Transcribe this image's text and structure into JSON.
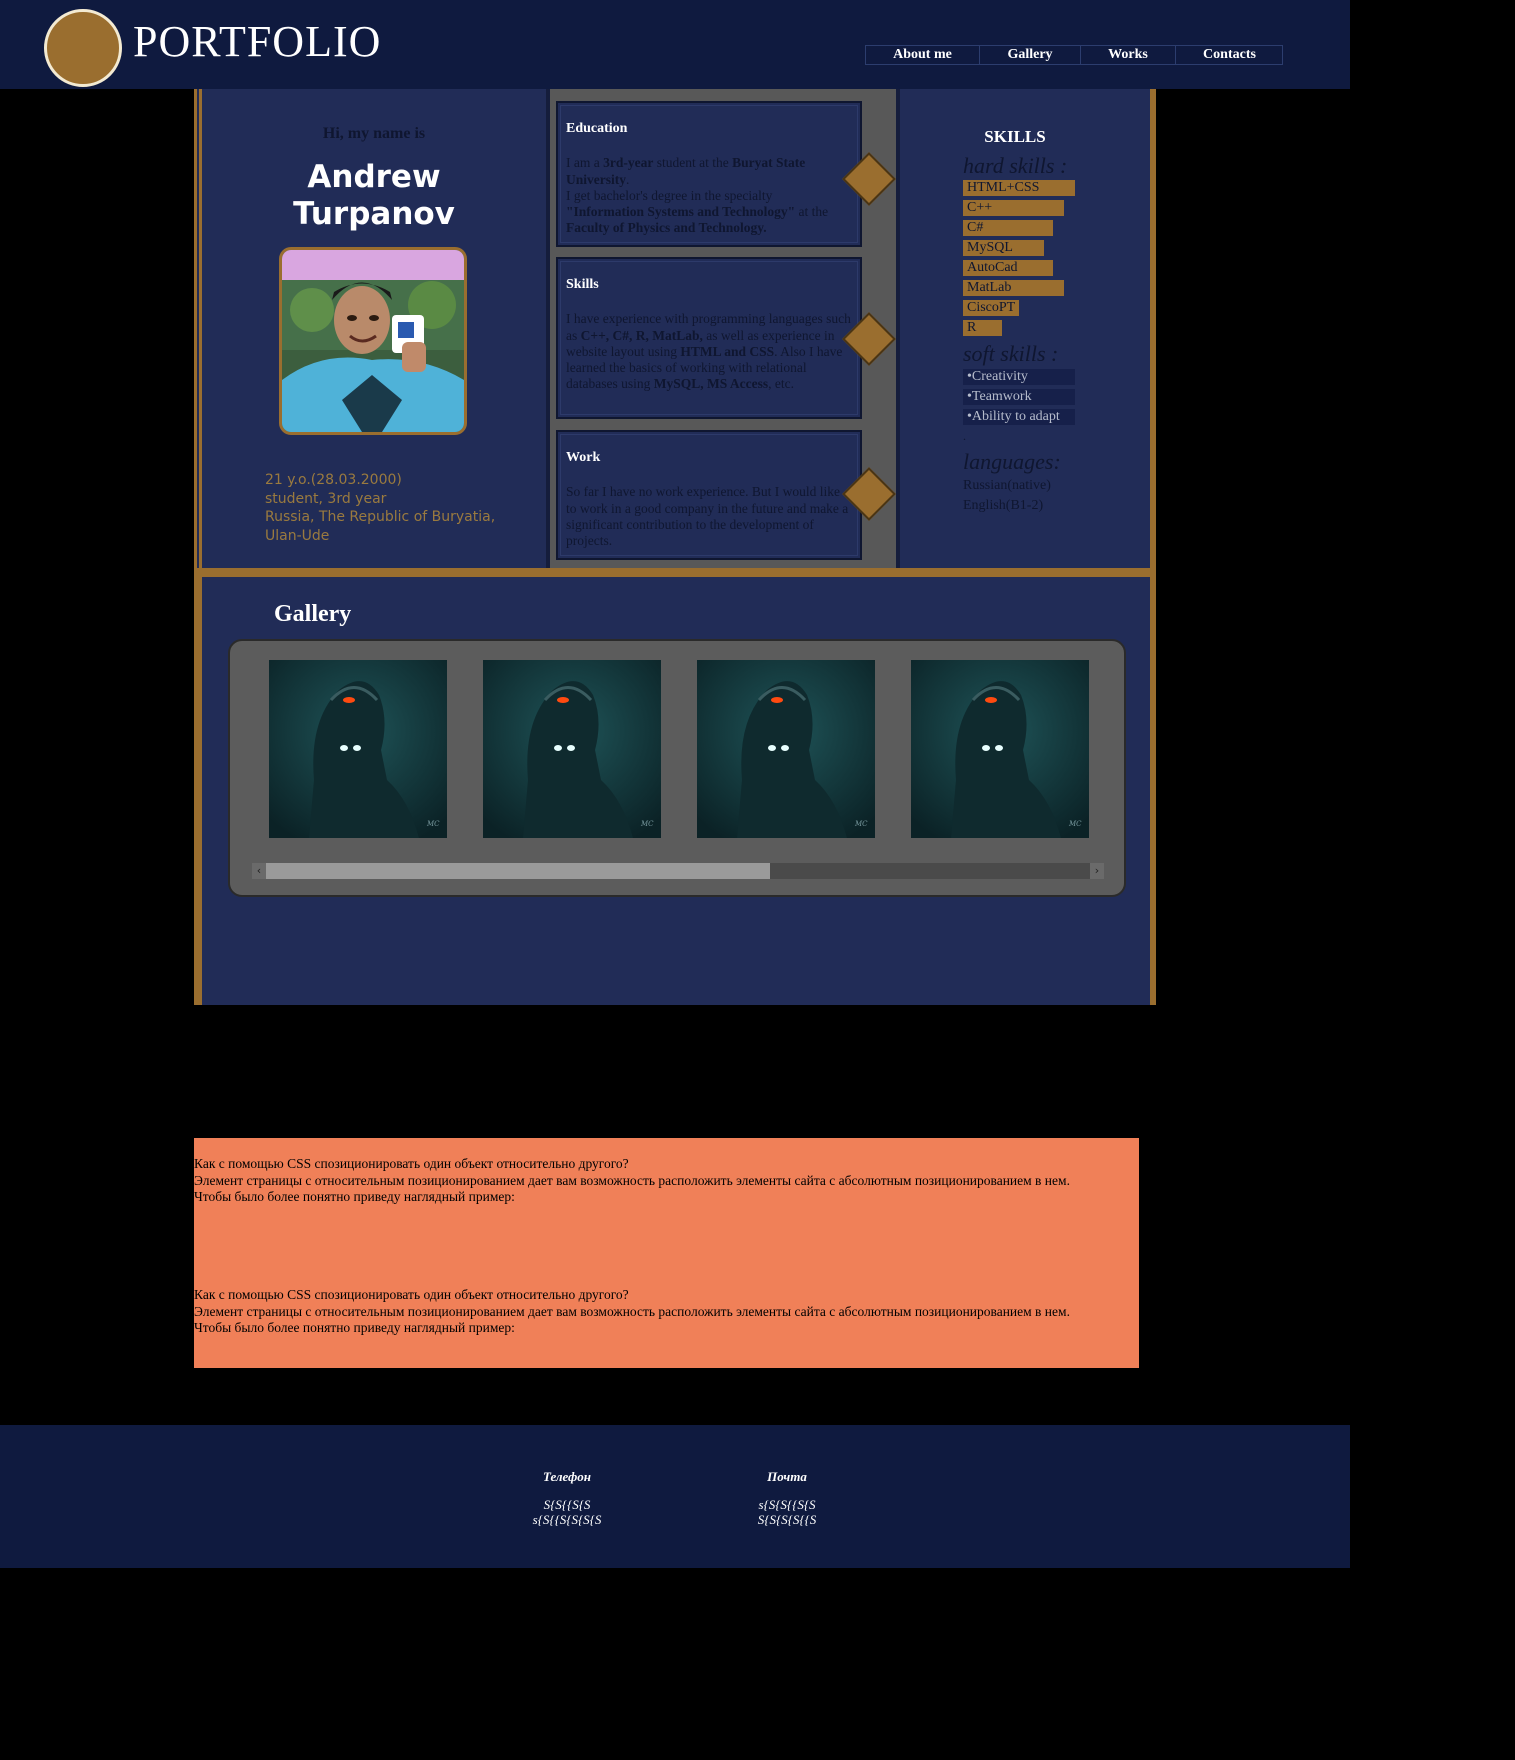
{
  "header": {
    "title": "PORTFOLIO",
    "nav": [
      "About me",
      "Gallery",
      "Works",
      "Contacts"
    ]
  },
  "about": {
    "greeting": "Hi, my name is",
    "first_name": "Andrew",
    "last_name": "Turpanov",
    "info": [
      "21 y.o.(28.03.2000)",
      "student, 3rd year",
      "Russia, The Republic of Buryatia,",
      "Ulan-Ude"
    ]
  },
  "cards": {
    "education": {
      "title": "Education"
    },
    "skills": {
      "title": "Skills"
    },
    "work": {
      "title": "Work",
      "text": "So far I have no work experience. But I would like to work in a good company in the future and make a significant contribution to the development of projects."
    }
  },
  "skills": {
    "title": "SKILLS",
    "hard_title": "hard skills :",
    "hard": [
      {
        "label": "HTML+CSS",
        "level": 1.0
      },
      {
        "label": "C++",
        "level": 0.9
      },
      {
        "label": "C#",
        "level": 0.8
      },
      {
        "label": "MySQL",
        "level": 0.72
      },
      {
        "label": "AutoCad",
        "level": 0.8
      },
      {
        "label": "MatLab",
        "level": 0.9
      },
      {
        "label": "CiscoPT",
        "level": 0.5
      },
      {
        "label": "R",
        "level": 0.35
      }
    ],
    "soft_title": "soft skills :",
    "soft": [
      "•Creativity",
      "•Teamwork",
      "•Ability to adapt"
    ],
    "dot": ".",
    "lang_title": "languages:",
    "languages": [
      "Russian(native)",
      "English(B1-2)"
    ]
  },
  "gallery": {
    "title": "Gallery",
    "watermark": "MC",
    "scroll_left": "‹",
    "scroll_right": "›"
  },
  "article": {
    "line1": "Как с помощью CSS спозиционировать один объект относительно другого?",
    "line2": "Элемент страницы с относительным позиционированием дает вам возможность расположить элементы сайта с абсолютным позиционированием в нем.",
    "line3": "Чтобы было более понятно приведу наглядный пример:"
  },
  "footer": {
    "phone_title": "Телефон",
    "phone_lines": [
      "S{S{{S{S",
      "s{S{{S{S{S{S"
    ],
    "mail_title": "Почта",
    "mail_lines": [
      "s{S{S{{S{S",
      "S{S{S{S{{S"
    ]
  },
  "colors": {
    "header_bg": "#0f1a3f",
    "panel_bg": "#212c57",
    "gold": "#9a6e2f",
    "orange": "#f08058"
  }
}
